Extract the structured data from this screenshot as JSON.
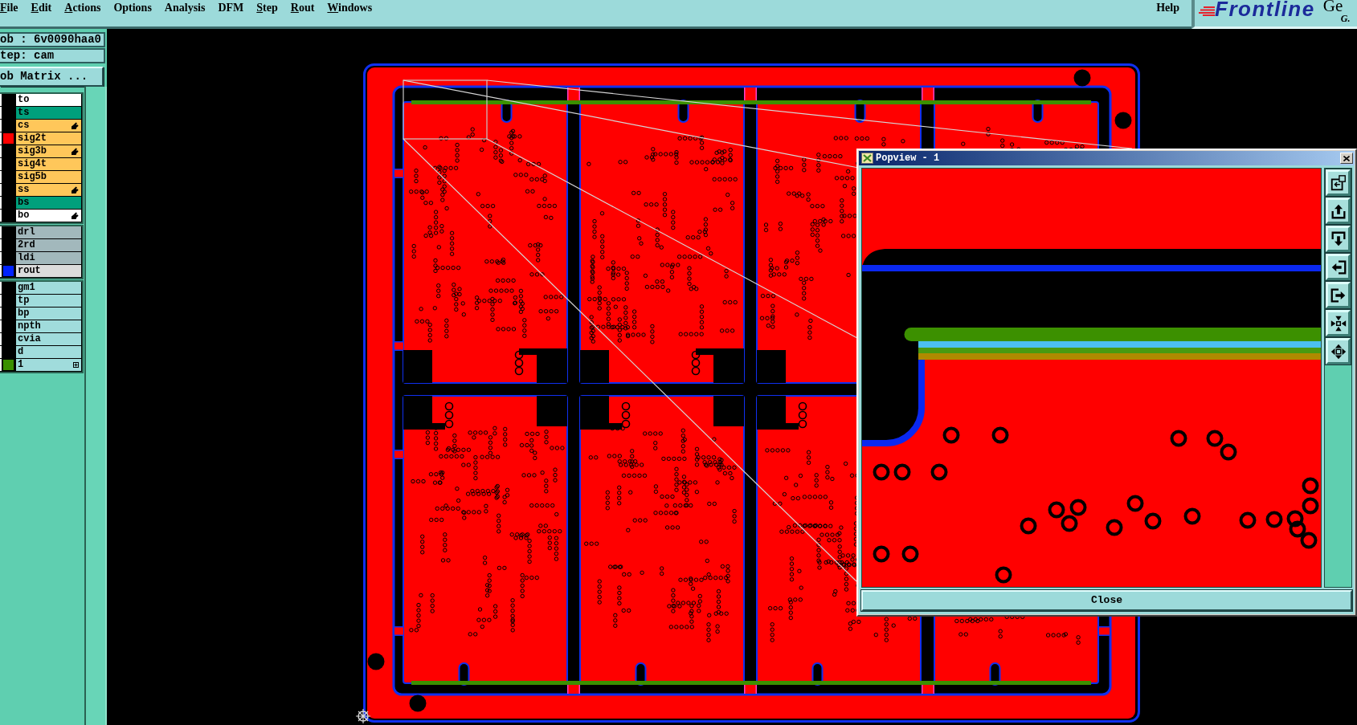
{
  "menu_bar": {
    "items": [
      {
        "label": "File",
        "underline_first": true
      },
      {
        "label": "Edit",
        "underline_first": true
      },
      {
        "label": "Actions",
        "underline_first": true
      },
      {
        "label": "Options",
        "underline_first": false
      },
      {
        "label": "Analysis",
        "underline_first": false
      },
      {
        "label": "DFM",
        "underline_first": false
      },
      {
        "label": "Step",
        "underline_first": true
      },
      {
        "label": "Rout",
        "underline_first": true
      },
      {
        "label": "Windows",
        "underline_first": true
      }
    ],
    "help": "Help"
  },
  "logo": {
    "brand": "Frontline",
    "product": "Ge",
    "subtitle": "G."
  },
  "job_panel": {
    "job": "ob : 6v0090haa0",
    "step": "tep: cam",
    "matrix_button": "ob Matrix ..."
  },
  "layer_groups": [
    {
      "layers": [
        {
          "name": "to",
          "kind": "silk_screen",
          "pointer": false,
          "expandable": false
        },
        {
          "name": "ts",
          "kind": "solder_mask",
          "pointer": false,
          "expandable": false
        },
        {
          "name": "cs",
          "kind": "signal",
          "pointer": true,
          "expandable": false
        },
        {
          "name": "sig2t",
          "kind": "signal",
          "pointer": false,
          "expandable": false,
          "color": "#ff0000"
        },
        {
          "name": "sig3b",
          "kind": "signal",
          "pointer": true,
          "expandable": false
        },
        {
          "name": "sig4t",
          "kind": "signal",
          "pointer": false,
          "expandable": false
        },
        {
          "name": "sig5b",
          "kind": "signal",
          "pointer": false,
          "expandable": false
        },
        {
          "name": "ss",
          "kind": "signal",
          "pointer": true,
          "expandable": false
        },
        {
          "name": "bs",
          "kind": "solder_mask",
          "pointer": false,
          "expandable": false
        },
        {
          "name": "bo",
          "kind": "silk_screen",
          "pointer": true,
          "expandable": false
        }
      ]
    },
    {
      "layers": [
        {
          "name": "drl",
          "kind": "drill",
          "pointer": false,
          "expandable": false
        },
        {
          "name": "2rd",
          "kind": "drill",
          "pointer": false,
          "expandable": false
        },
        {
          "name": "ldi",
          "kind": "drill",
          "pointer": false,
          "expandable": false
        },
        {
          "name": "rout",
          "kind": "rout",
          "pointer": false,
          "expandable": false,
          "color": "#0022ff"
        }
      ]
    },
    {
      "layers": [
        {
          "name": "gm1",
          "kind": "document",
          "pointer": false,
          "expandable": false
        },
        {
          "name": "tp",
          "kind": "document",
          "pointer": false,
          "expandable": false
        },
        {
          "name": "bp",
          "kind": "document",
          "pointer": false,
          "expandable": false
        },
        {
          "name": "npth",
          "kind": "document",
          "pointer": false,
          "expandable": false
        },
        {
          "name": "cvia",
          "kind": "document",
          "pointer": false,
          "expandable": false
        },
        {
          "name": "d",
          "kind": "document",
          "pointer": false,
          "expandable": false
        },
        {
          "name": "1",
          "kind": "document",
          "pointer": false,
          "expandable": true,
          "color": "#3a9000"
        }
      ]
    }
  ],
  "popview": {
    "title": "Popview - 1",
    "close_button": "Close"
  }
}
